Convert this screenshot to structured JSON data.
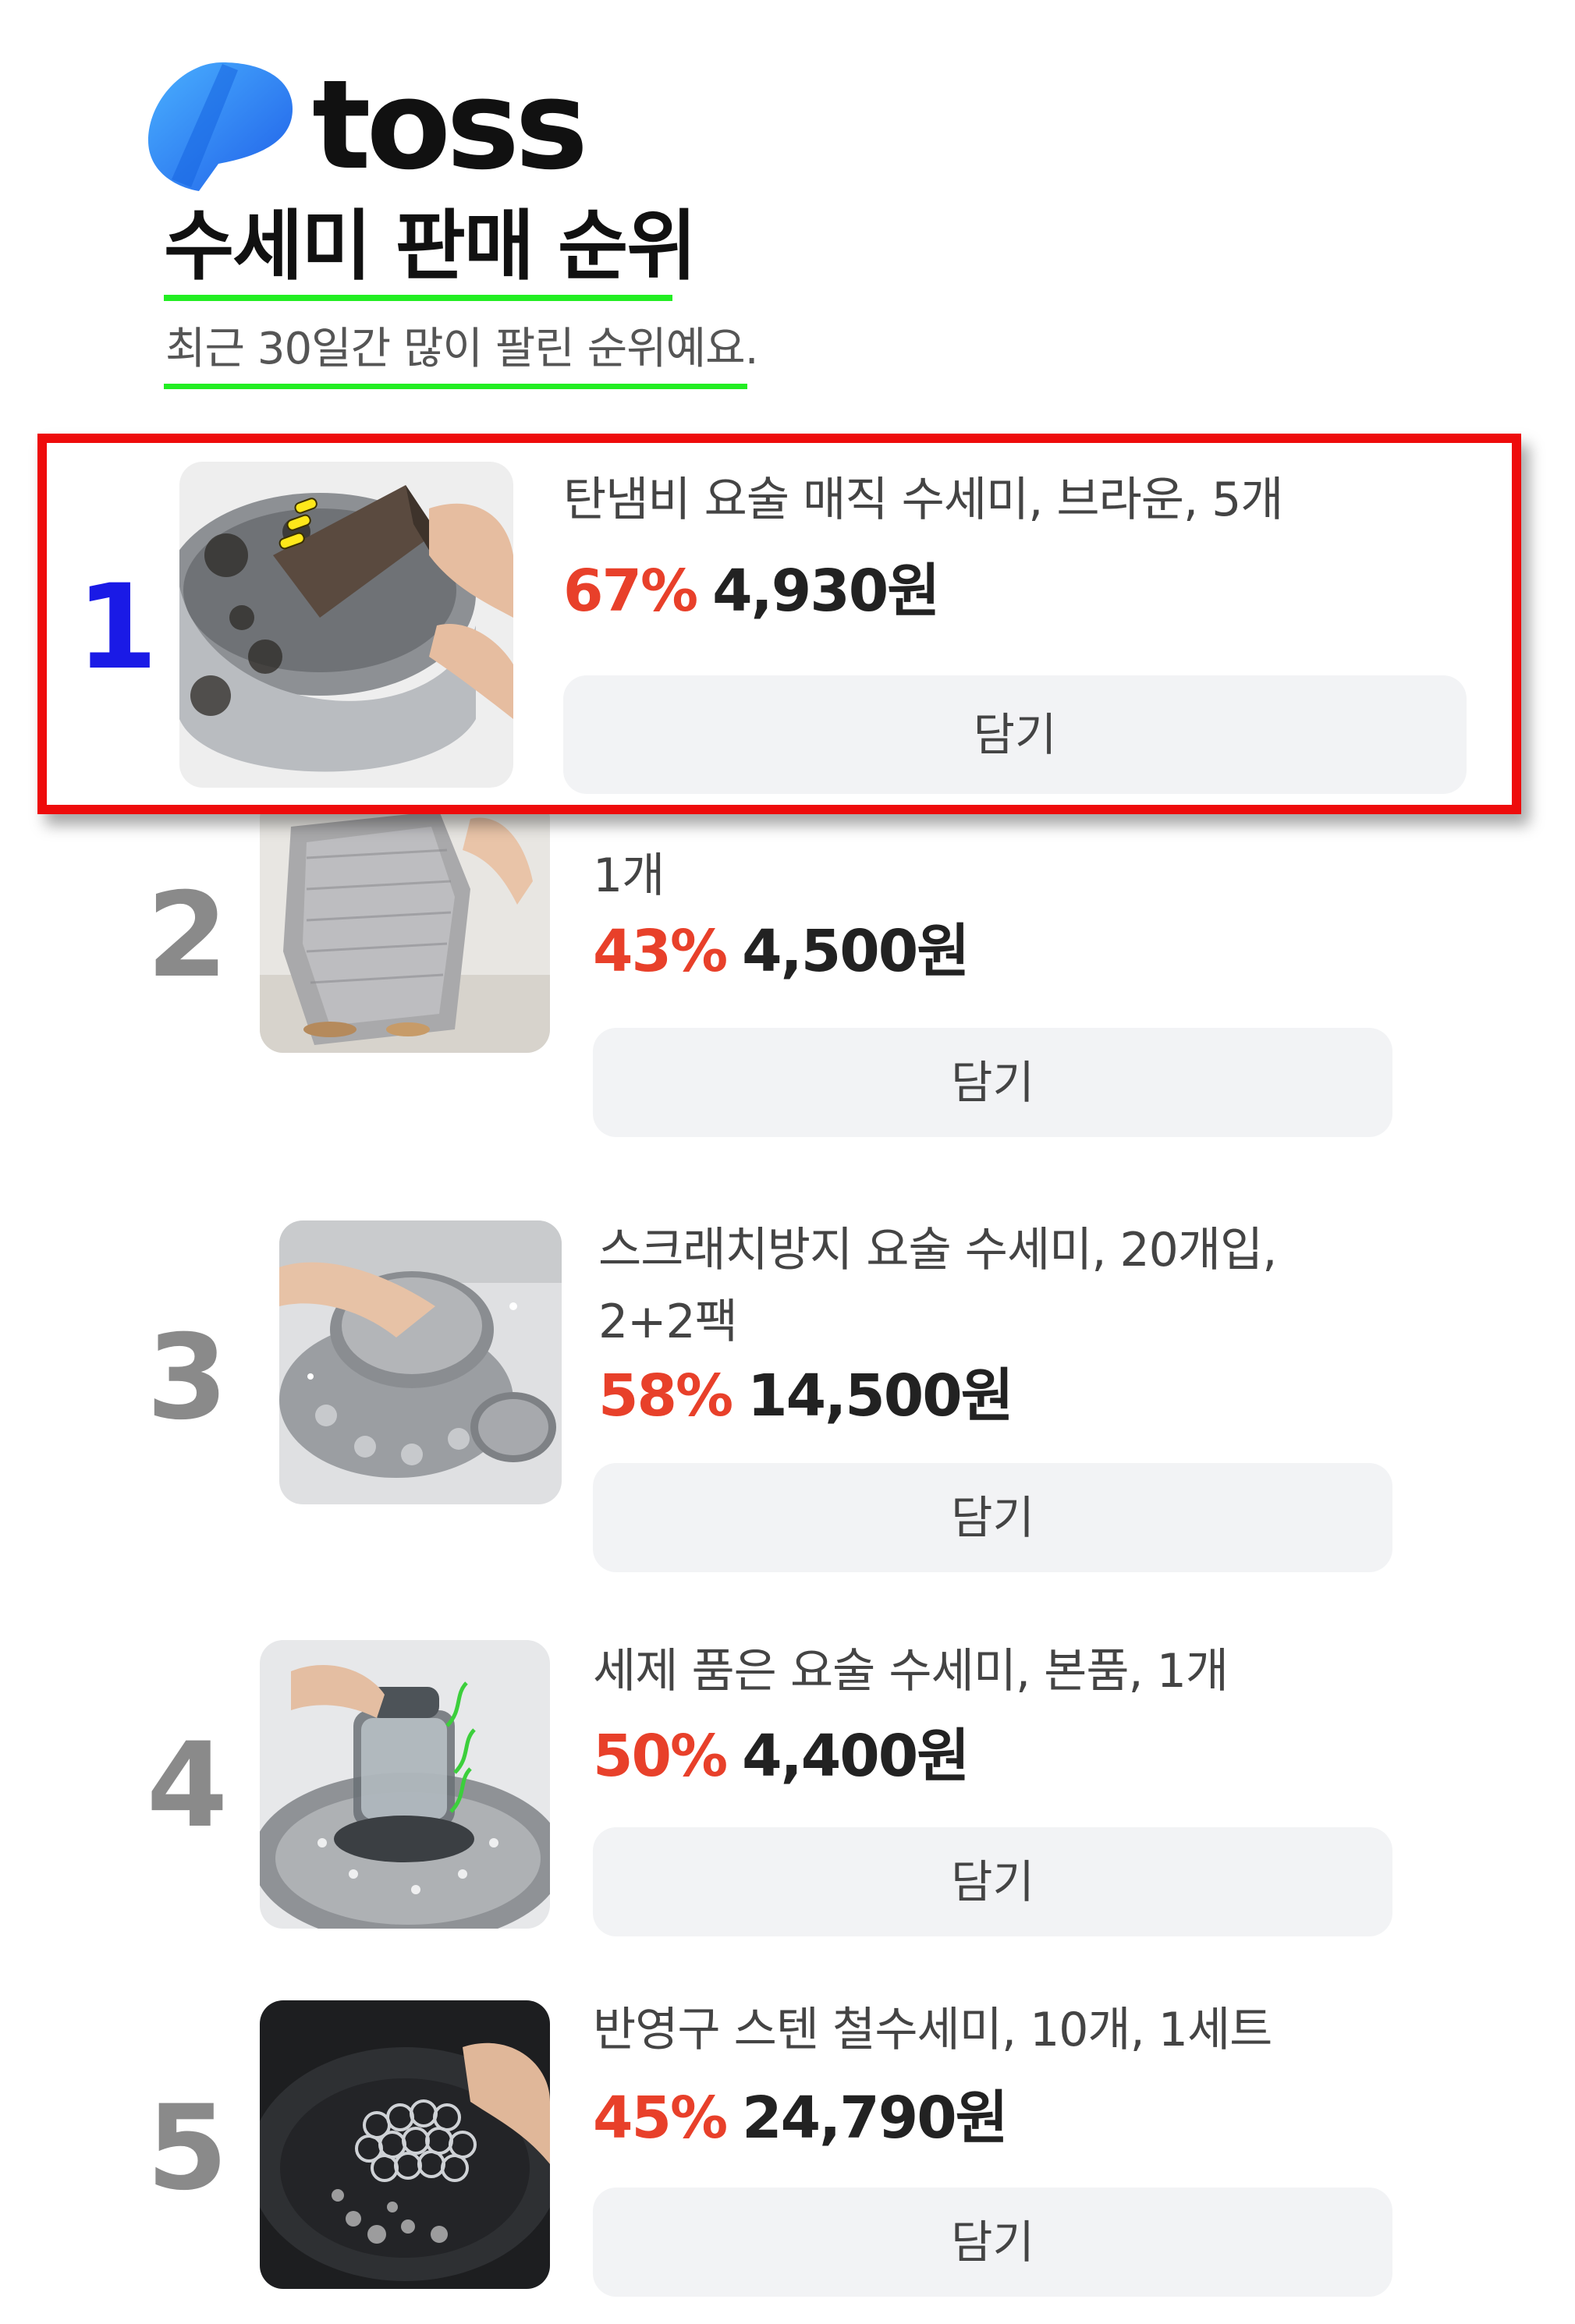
{
  "brand": {
    "name": "toss",
    "logo_color": "#2a6cf6"
  },
  "header": {
    "title": "수세미 판매 순위",
    "subtitle": "최근 30일간 많이 팔린 순위예요.",
    "underline_color": "#22ee22"
  },
  "colors": {
    "discount": "#e8402a",
    "highlight_border": "#ee0b0b",
    "rank1": "#1a1ae6",
    "rank": "#8a8a8a",
    "button_bg": "#f2f3f5"
  },
  "items": [
    {
      "rank": "1",
      "name_line1": "탄냄비 요술 매직 수세미, 브라운, 5개",
      "name_line2": "",
      "discount": "67%",
      "price": "4,930원",
      "button": "담기",
      "thumb_icon": "magic-sponge-pot-image"
    },
    {
      "rank": "2",
      "name_line1": "",
      "name_line2": "1개",
      "discount": "43%",
      "price": "4,500원",
      "button": "담기",
      "thumb_icon": "mesh-cloth-image"
    },
    {
      "rank": "3",
      "name_line1": "스크래치방지 요술 수세미, 20개입,",
      "name_line2": "2+2팩",
      "discount": "58%",
      "price": "14,500원",
      "button": "담기",
      "thumb_icon": "round-scrubber-image"
    },
    {
      "rank": "4",
      "name_line1": "세제 품은 요술 수세미, 본품, 1개",
      "name_line2": "",
      "discount": "50%",
      "price": "4,400원",
      "button": "담기",
      "thumb_icon": "soap-dispenser-brush-image"
    },
    {
      "rank": "5",
      "name_line1": "반영구 스텐 철수세미, 10개, 1세트",
      "name_line2": "",
      "discount": "45%",
      "price": "24,790원",
      "button": "담기",
      "thumb_icon": "chainmail-scrubber-image"
    }
  ]
}
